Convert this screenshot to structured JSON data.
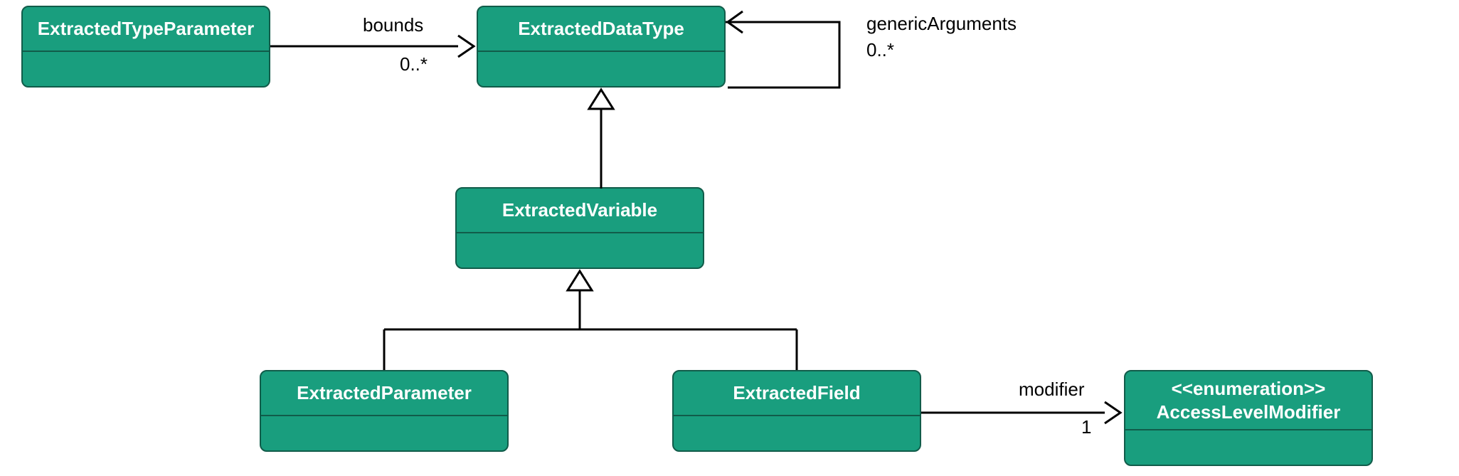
{
  "classes": {
    "extractedTypeParameter": {
      "title": "ExtractedTypeParameter"
    },
    "extractedDataType": {
      "title": "ExtractedDataType"
    },
    "extractedVariable": {
      "title": "ExtractedVariable"
    },
    "extractedParameter": {
      "title": "ExtractedParameter"
    },
    "extractedField": {
      "title": "ExtractedField"
    },
    "accessLevelModifier": {
      "stereotype": "<<enumeration>>",
      "title": "AccessLevelModifier"
    }
  },
  "associations": {
    "bounds": {
      "label": "bounds",
      "multiplicity": "0..*"
    },
    "generic": {
      "label": "genericArguments",
      "multiplicity": "0..*"
    },
    "modifier": {
      "label": "modifier",
      "multiplicity": "1"
    }
  },
  "colors": {
    "classFill": "#199e7e",
    "classBorder": "#115c4a",
    "text": "#ffffff",
    "connector": "#000000"
  }
}
